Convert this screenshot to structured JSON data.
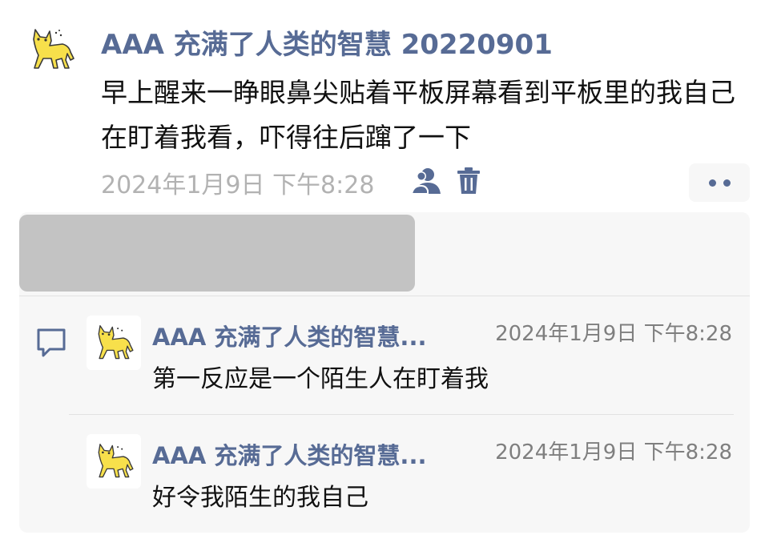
{
  "post": {
    "author": "AAA 充满了人类的智慧 20220901",
    "text": "早上醒来一睁眼鼻尖贴着平板屏幕看到平板里的我自己在盯着我看，吓得往后蹿了一下",
    "timestamp": "2024年1月9日 下午8:28",
    "avatar_icon": "yellow-cat-icon",
    "visibility_icon": "person-icon",
    "delete_icon": "trash-icon",
    "more_icon": "two-dots-icon"
  },
  "comments_section": {
    "comment_icon": "speech-bubble-icon",
    "comments": [
      {
        "author": "AAA 充满了人类的智慧...",
        "time": "2024年1月9日 下午8:28",
        "text": "第一反应是一个陌生人在盯着我"
      },
      {
        "author": "AAA 充满了人类的智慧...",
        "time": "2024年1月9日 下午8:28",
        "text": "好令我陌生的我自己"
      }
    ]
  },
  "colors": {
    "link": "#576b95",
    "meta": "#b2b2b2",
    "panel": "#f7f7f7",
    "cat": "#f7e04b"
  }
}
